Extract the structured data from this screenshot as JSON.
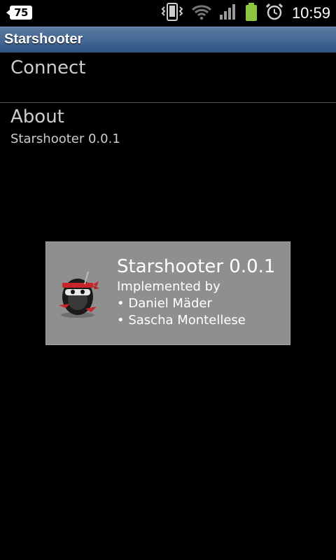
{
  "status_bar": {
    "notification_count": "75",
    "time": "10:59",
    "icons": [
      "vibrate-icon",
      "wifi-icon",
      "signal-icon",
      "battery-icon",
      "alarm-icon"
    ]
  },
  "app": {
    "title": "Starshooter"
  },
  "preferences": [
    {
      "title": "Connect",
      "summary": ""
    },
    {
      "title": "About",
      "summary": "Starshooter 0.0.1"
    }
  ],
  "toast": {
    "title": "Starshooter 0.0.1",
    "lines": [
      "Implemented by",
      "• Daniel Mäder",
      "• Sascha Montellese"
    ],
    "logo": "ninja-logo"
  },
  "colors": {
    "title_bar": "#2f5584",
    "toast_bg": "#8f8f8f",
    "battery": "#8bc63e"
  }
}
